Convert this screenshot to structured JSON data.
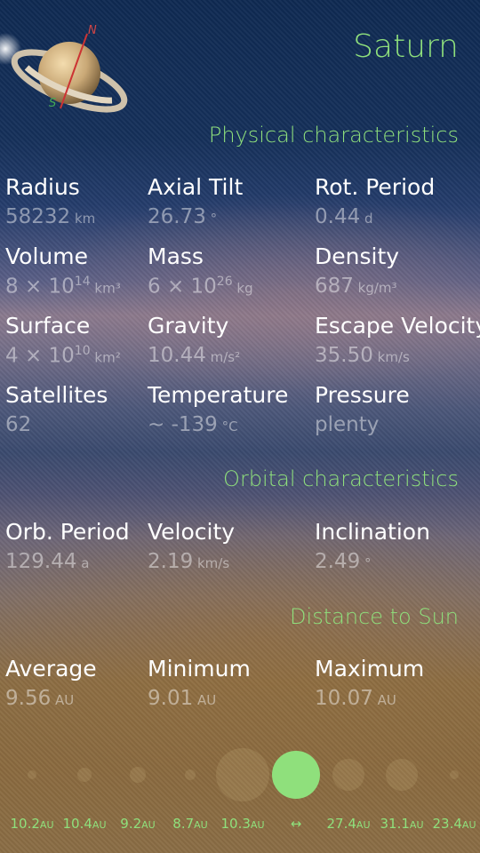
{
  "planet": {
    "name": "Saturn"
  },
  "sections": {
    "physical": "Physical characteristics",
    "orbital": "Orbital characteristics",
    "distance": "Distance to Sun"
  },
  "physical": [
    {
      "label": "Radius",
      "value": "58232",
      "unit": "km"
    },
    {
      "label": "Axial Tilt",
      "value": "26.73",
      "unit": "°"
    },
    {
      "label": "Rot. Period",
      "value": "0.44",
      "unit": "d"
    },
    {
      "label": "Volume",
      "value": "8 × 10",
      "sup": "14",
      "unit": "km³"
    },
    {
      "label": "Mass",
      "value": "6 × 10",
      "sup": "26",
      "unit": "kg"
    },
    {
      "label": "Density",
      "value": "687",
      "unit": "kg/m³"
    },
    {
      "label": "Surface",
      "value": "4 × 10",
      "sup": "10",
      "unit": "km²"
    },
    {
      "label": "Gravity",
      "value": "10.44",
      "unit": "m/s²"
    },
    {
      "label": "Escape Velocity",
      "value": "35.50",
      "unit": "km/s"
    },
    {
      "label": "Satellites",
      "value": "62",
      "unit": ""
    },
    {
      "label": "Temperature",
      "value": "~ -139",
      "unit": "°C"
    },
    {
      "label": "Pressure",
      "value": "plenty",
      "unit": ""
    }
  ],
  "orbital": [
    {
      "label": "Orb. Period",
      "value": "129.44",
      "unit": "a"
    },
    {
      "label": "Velocity",
      "value": "2.19",
      "unit": "km/s"
    },
    {
      "label": "Inclination",
      "value": "2.49",
      "unit": "°"
    }
  ],
  "distance": [
    {
      "label": "Average",
      "value": "9.56",
      "unit": "AU"
    },
    {
      "label": "Minimum",
      "value": "9.01",
      "unit": "AU"
    },
    {
      "label": "Maximum",
      "value": "10.07",
      "unit": "AU"
    }
  ],
  "scale": [
    {
      "value": "10.2",
      "unit": "AU"
    },
    {
      "value": "10.4",
      "unit": "AU"
    },
    {
      "value": "9.2",
      "unit": "AU"
    },
    {
      "value": "8.7",
      "unit": "AU"
    },
    {
      "value": "10.3",
      "unit": "AU"
    },
    {
      "value": "↔",
      "unit": ""
    },
    {
      "value": "27.4",
      "unit": "AU"
    },
    {
      "value": "31.1",
      "unit": "AU"
    },
    {
      "value": "23.4",
      "unit": "AU"
    }
  ],
  "compass": {
    "north": "N",
    "south": "S"
  },
  "colors": {
    "accent": "#8fe07c"
  }
}
